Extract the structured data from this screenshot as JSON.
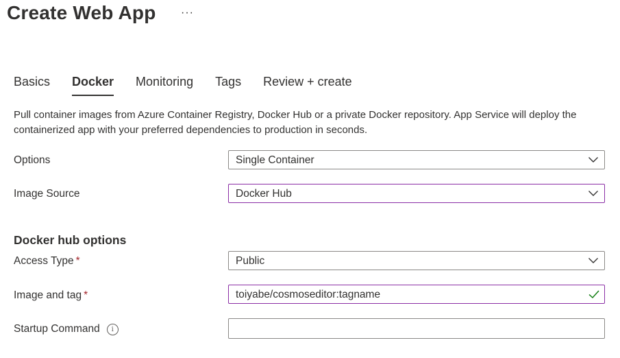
{
  "header": {
    "title": "Create Web App",
    "more_glyph": "···"
  },
  "tabs": [
    {
      "label": "Basics",
      "active": false
    },
    {
      "label": "Docker",
      "active": true
    },
    {
      "label": "Monitoring",
      "active": false
    },
    {
      "label": "Tags",
      "active": false
    },
    {
      "label": "Review + create",
      "active": false
    }
  ],
  "description": "Pull container images from Azure Container Registry, Docker Hub or a private Docker repository. App Service will deploy the containerized app with your preferred dependencies to production in seconds.",
  "form": {
    "options": {
      "label": "Options",
      "value": "Single Container"
    },
    "image_source": {
      "label": "Image Source",
      "value": "Docker Hub"
    },
    "docker_hub_heading": "Docker hub options",
    "access_type": {
      "label": "Access Type",
      "required": "*",
      "value": "Public"
    },
    "image_and_tag": {
      "label": "Image and tag",
      "required": "*",
      "value": "toiyabe/cosmoseditor:tagname"
    },
    "startup_command": {
      "label": "Startup Command",
      "value": "",
      "info_glyph": "i"
    }
  },
  "icons": {
    "more": "more-horizontal-icon",
    "chevron": "chevron-down-icon",
    "valid": "checkmark-icon",
    "info": "info-icon"
  },
  "colors": {
    "text": "#323130",
    "required": "#a4262c",
    "focus_border": "#8a2da5",
    "border": "#8a8886",
    "valid_check": "#107c10"
  }
}
